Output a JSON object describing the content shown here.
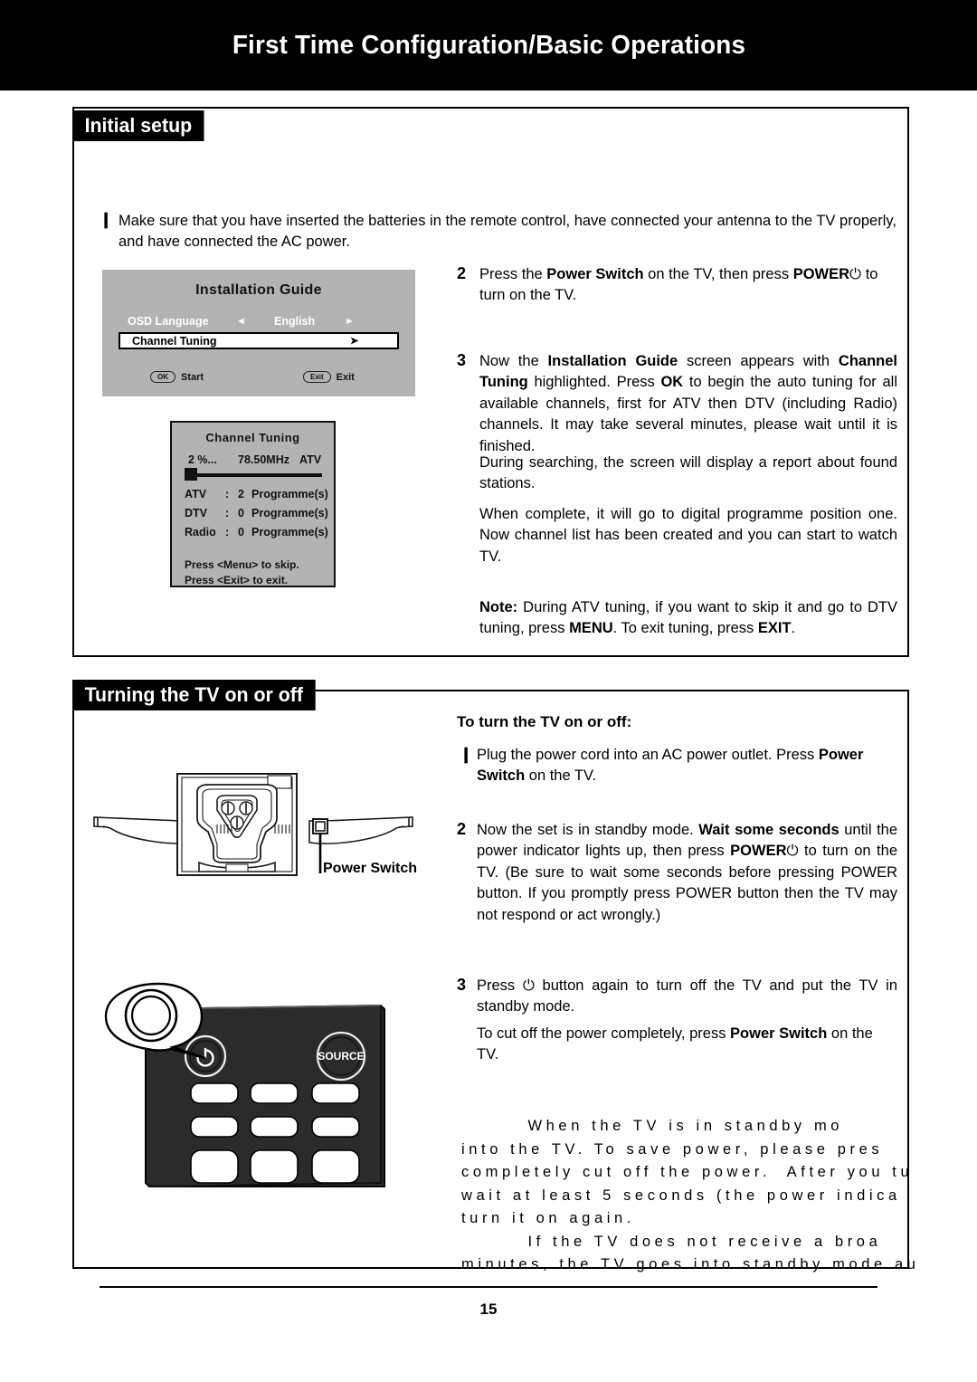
{
  "header": {
    "title": "First Time Configuration/Basic Operations"
  },
  "sections": {
    "initial": {
      "tab_label": "Initial setup"
    },
    "turning": {
      "tab_label": "Turning the TV on or off"
    }
  },
  "initial_setup": {
    "step1": {
      "marker": "❙",
      "text_plain": "Make sure that you have inserted the batteries in the remote control, have connected your antenna to the TV properly, and have connected the AC power."
    },
    "step2": {
      "number": "2",
      "line1_a": "Press the ",
      "line1_b": "Power Switch",
      "line1_c": " on the TV, then press ",
      "line1_d": "POWER",
      "line1_icon": "⏻",
      "line1_e": " to turn on the TV."
    },
    "step3": {
      "number": "3",
      "p1_a": "Now the ",
      "p1_b": "Installation Guide",
      "p1_c": " screen appears with ",
      "p1_d": "Channel Tuning",
      "p1_e": " highlighted. Press ",
      "p1_f": "OK",
      "p1_g": " to begin the auto tuning for all available channels, first for ATV then DTV (including Radio) channels. It may take several minutes, please wait until it is finished.",
      "p2": "During searching, the screen will display a report about found stations.",
      "p3": "When complete, it will go to digital programme position one. Now channel list has been created and you can start to watch TV.",
      "note_label": "Note:",
      "note_a": " During ATV tuning, if you want to skip it and go to DTV tuning, press ",
      "note_b": "MENU",
      "note_c": ". To exit tuning, press ",
      "note_d": "EXIT",
      "note_e": "."
    }
  },
  "osd_installation_guide": {
    "title": "Installation Guide",
    "rows": [
      {
        "label": "OSD Language",
        "left_arrow": "◄",
        "value": "English",
        "right_arrow": "►"
      },
      {
        "label": "Channel Tuning",
        "right_arrow": "➤"
      }
    ],
    "footer": [
      {
        "key": "OK",
        "action": "Start"
      },
      {
        "key": "Exit",
        "action": "Exit"
      }
    ]
  },
  "osd_channel_tuning": {
    "title": "Channel  Tuning",
    "percent": "2  %...",
    "frequency": "78.50MHz",
    "mode": "ATV",
    "progress_percent": 2,
    "counts": [
      {
        "key": "ATV",
        "colon": ":",
        "num": "2",
        "unit": "Programme(s)"
      },
      {
        "key": "DTV",
        "colon": ":",
        "num": "0",
        "unit": "Programme(s)"
      },
      {
        "key": "Radio",
        "colon": ":",
        "num": "0",
        "unit": "Programme(s)"
      }
    ],
    "hint1": "Press <Menu> to skip.",
    "hint2": "Press <Exit> to exit."
  },
  "tv_illustration": {
    "callout_label": "Power Switch"
  },
  "control_panel": {
    "power_icon": "⏻",
    "source_label": "SOURCE"
  },
  "turning_on_off": {
    "heading": "To turn the TV on or off:",
    "step1": {
      "marker": "❙",
      "a": "Plug the power cord into an AC power outlet.  Press ",
      "b": "Power Switch",
      "c": " on the TV."
    },
    "step2": {
      "number": "2",
      "a": "Now the set is in standby mode. ",
      "b": "Wait some seconds",
      "c": " until the power indicator lights up, then press ",
      "d": "POWER",
      "icon": "⏻",
      "e": " to turn on the TV. (Be sure to wait some seconds before pressing POWER button. If you promptly press POWER button then the TV may not respond or act wrongly.)"
    },
    "step3": {
      "number": "3",
      "a": "Press ",
      "icon": "⏻",
      "b": " button again to turn off the TV and put the TV in standby mode.",
      "p2_a": "To cut off the power completely, press ",
      "p2_b": "Power Switch",
      "p2_c": " on the TV."
    }
  },
  "bottom_note": {
    "text": "        When the TV is in standby mo\ninto the TV. To save power, please pres\ncompletely cut off the power.  After you tu\nwait at least 5 seconds (the power indica\nturn it on again.\n        If the TV does not receive a broa\nminutes, the TV goes into standby mode au"
  },
  "footer": {
    "page_number": "15"
  },
  "colors": {
    "banner_bg": "#000000",
    "osd_bg": "#b3b3b3",
    "osd_highlight_bg": "#ffffff",
    "panel_dark": "#2b2b2b"
  }
}
